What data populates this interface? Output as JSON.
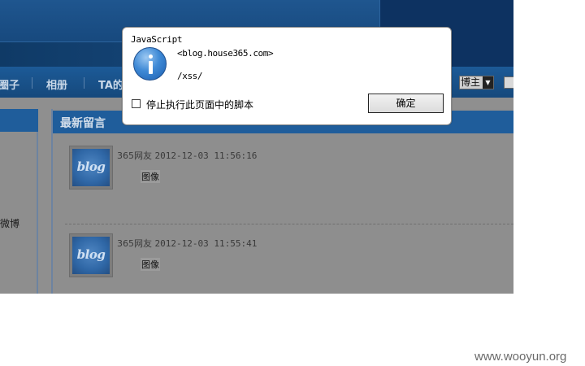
{
  "page": {
    "nav": {
      "items": [
        "圈子",
        "相册",
        "TA的"
      ],
      "select_value": "博主"
    },
    "left": {
      "weibo_text": "微博"
    },
    "section_title": "最新留言",
    "messages": [
      {
        "author": "365网友",
        "time": "2012-12-03 11:56:16",
        "avatar_text": "blog",
        "content": "图像"
      },
      {
        "author": "365网友",
        "time": "2012-12-03 11:55:41",
        "avatar_text": "blog",
        "content": "图像"
      }
    ]
  },
  "dialog": {
    "title": "JavaScript",
    "icon": "info-icon",
    "message_line1": "<blog.house365.com>",
    "message_line2": "/xss/",
    "checkbox_label": "停止执行此页面中的脚本",
    "ok_label": "确定"
  },
  "watermark": "www.wooyun.org",
  "colors": {
    "nav_bar": "#1c5a97",
    "section_header": "#1f5d9b",
    "dim_overlay": "#8e8e8e",
    "dialog_bg": "#ffffff"
  }
}
